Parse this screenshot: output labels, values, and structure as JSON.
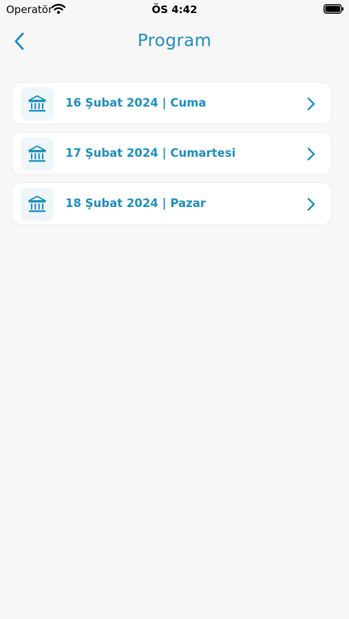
{
  "status_bar": {
    "carrier": "Operatör",
    "time": "ÖS 4:42"
  },
  "header": {
    "title": "Program"
  },
  "days": [
    {
      "label": "16 Şubat 2024 | Cuma"
    },
    {
      "label": "17 Şubat 2024 | Cumartesi"
    },
    {
      "label": "18 Şubat 2024 | Pazar"
    }
  ],
  "colors": {
    "accent": "#1d8fbf",
    "background": "#f7f7f7",
    "card": "#ffffff",
    "icon_bg": "#eef6fa"
  },
  "icons": {
    "back": "chevron-left-icon",
    "item": "bank-icon",
    "item_arrow": "chevron-right-icon"
  }
}
